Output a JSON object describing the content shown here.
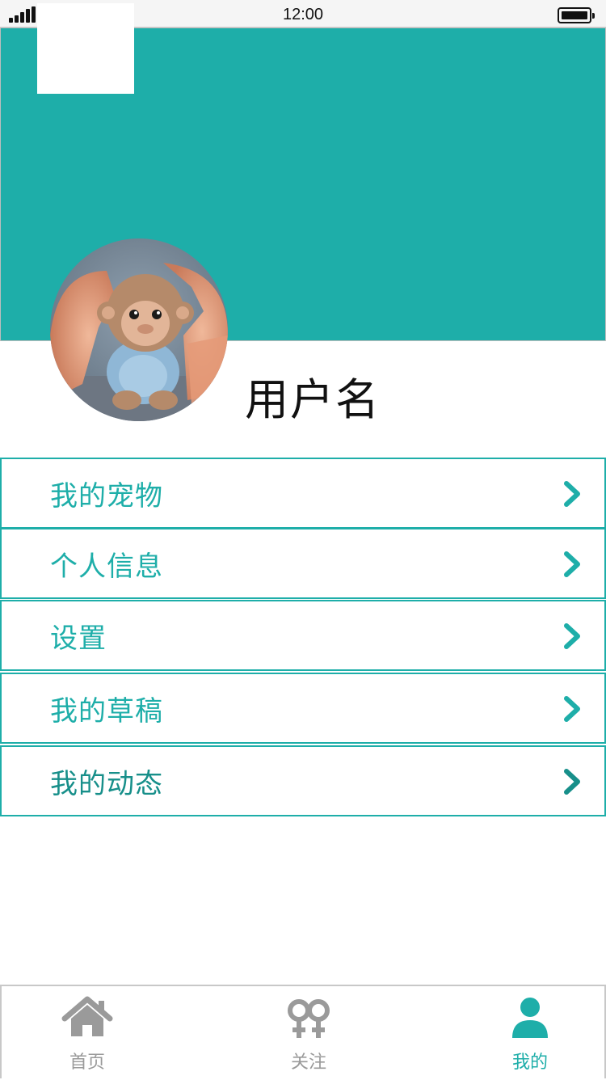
{
  "status_bar": {
    "time": "12:00"
  },
  "profile": {
    "username": "用户名"
  },
  "menu": {
    "items": [
      {
        "label": "我的宠物"
      },
      {
        "label": "个人信息"
      },
      {
        "label": "设置"
      },
      {
        "label": "我的草稿"
      },
      {
        "label": "我的动态"
      }
    ]
  },
  "tabbar": {
    "tabs": [
      {
        "label": "首页",
        "icon": "home-icon",
        "active": false
      },
      {
        "label": "关注",
        "icon": "gender-icon",
        "active": false
      },
      {
        "label": "我的",
        "icon": "user-icon",
        "active": true
      }
    ]
  },
  "colors": {
    "accent": "#1eaea9",
    "inactive": "#9a9a9a",
    "text": "#111111"
  }
}
